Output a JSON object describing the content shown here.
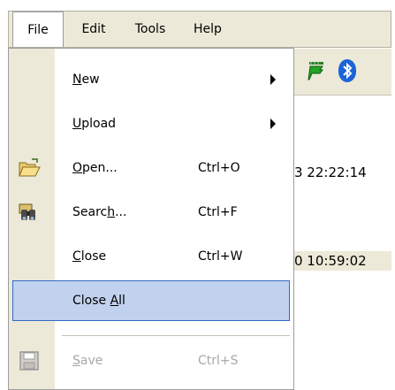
{
  "menubar": {
    "items": [
      "File",
      "Edit",
      "Tools",
      "Help"
    ],
    "active": "File"
  },
  "background": {
    "row1_text": "3 22:22:14",
    "row2_text": "0 10:59:02",
    "toolbar_icons": [
      "antenna-flag-icon",
      "bluetooth-icon"
    ]
  },
  "file_menu": {
    "items": [
      {
        "label": "New",
        "mnemonic_index": 0,
        "shortcut": "",
        "submenu": true,
        "icon": ""
      },
      {
        "label": "Upload",
        "mnemonic_index": 0,
        "shortcut": "",
        "submenu": true,
        "icon": ""
      },
      {
        "label": "Open...",
        "mnemonic_index": 0,
        "shortcut": "Ctrl+O",
        "submenu": false,
        "icon": "open-folder-icon"
      },
      {
        "label": "Search...",
        "mnemonic_index": 5,
        "shortcut": "Ctrl+F",
        "submenu": false,
        "icon": "binoculars-icon"
      },
      {
        "label": "Close",
        "mnemonic_index": 0,
        "shortcut": "Ctrl+W",
        "submenu": false,
        "icon": ""
      },
      {
        "label": "Close All",
        "mnemonic_index": 6,
        "shortcut": "",
        "submenu": false,
        "icon": "",
        "highlighted": true
      },
      {
        "label": "Save",
        "mnemonic_index": 0,
        "shortcut": "Ctrl+S",
        "submenu": false,
        "icon": "save-disk-icon",
        "disabled": true
      }
    ]
  },
  "colors": {
    "menu_bg": "#ffffff",
    "icon_column": "#ece9d8",
    "highlight_bg": "#c1d2ee",
    "highlight_border": "#316ac5",
    "disabled_text": "#a8a8a8"
  }
}
